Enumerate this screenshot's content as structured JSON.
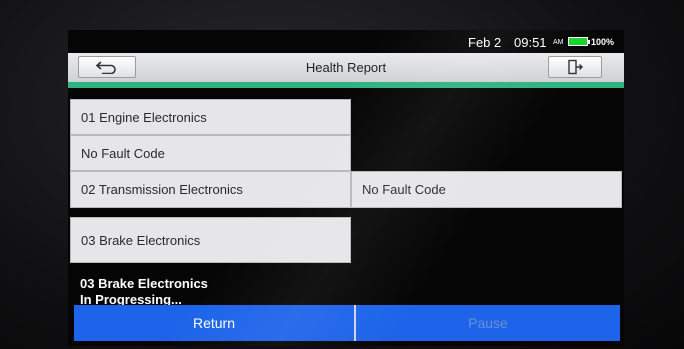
{
  "status": {
    "date": "Feb 2",
    "time": "09:51",
    "ampm": "AM",
    "battery": "100%",
    "battery_level": 1.0
  },
  "header": {
    "title": "Health Report",
    "back_icon": "back-arrow-icon",
    "exit_icon": "exit-door-icon"
  },
  "report": {
    "items": [
      {
        "label": "01 Engine Electronics",
        "result": "No Fault Code"
      },
      {
        "label": "02 Transmission Electronics",
        "result": "No Fault Code"
      },
      {
        "label": "03 Brake Electronics",
        "result": ""
      }
    ]
  },
  "progress": {
    "module": "03 Brake Electronics",
    "status": "In Progressing..."
  },
  "footer": {
    "return_label": "Return",
    "pause_label": "Pause"
  },
  "colors": {
    "accent": "#2fb37f",
    "button": "#1d64ea",
    "battery": "#18d42e"
  }
}
